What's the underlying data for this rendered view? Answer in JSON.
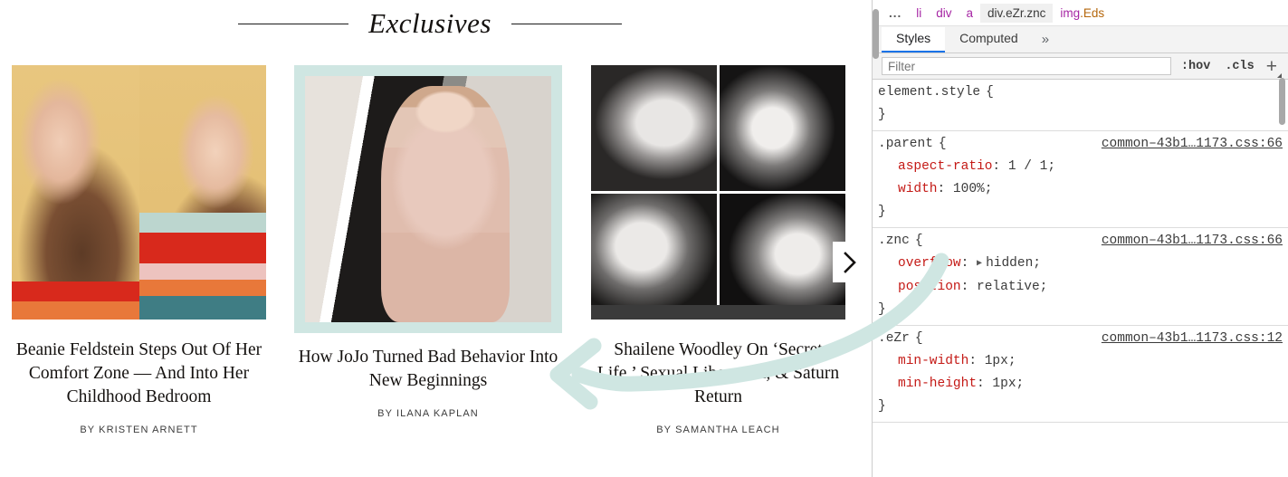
{
  "page": {
    "section": {
      "title": "Exclusives"
    },
    "carousel": {
      "next_label": "›",
      "cards": [
        {
          "headline": "Beanie Feldstein Steps Out Of Her Comfort Zone — And Into Her Childhood Bedroom",
          "byline": "BY KRISTEN ARNETT"
        },
        {
          "headline": "How JoJo Turned Bad Behavior Into New Beginnings",
          "byline": "BY ILANA KAPLAN"
        },
        {
          "headline": "Shailene Woodley On ‘Secret Life,’ Sexual Liberation, & Saturn Return",
          "byline": "BY SAMANTHA LEACH"
        }
      ]
    }
  },
  "devtools": {
    "breadcrumb": [
      {
        "text": "...",
        "kind": "dots"
      },
      {
        "text": "li",
        "kind": "tag"
      },
      {
        "text": "div",
        "kind": "tag"
      },
      {
        "text": "a",
        "kind": "tag"
      },
      {
        "text": "div.eZr.znc",
        "kind": "selected"
      },
      {
        "text": "img.Eds",
        "kind": "tagcls"
      }
    ],
    "breadcrumb_selected_tag": "div",
    "breadcrumb_selected_cls": ".eZr.znc",
    "breadcrumb_last_tag": "img",
    "breadcrumb_last_cls": ".Eds",
    "tabs": [
      {
        "label": "Styles",
        "active": true
      },
      {
        "label": "Computed",
        "active": false
      }
    ],
    "tabs_overflow": "»",
    "filter": {
      "placeholder": "Filter",
      "value": ""
    },
    "buttons": {
      "hov": ":hov",
      "cls": ".cls",
      "add": "+"
    },
    "rules": [
      {
        "selector": "element.style",
        "open": "{",
        "close": "}",
        "origin": "",
        "declarations": []
      },
      {
        "selector": ".parent",
        "open": "{",
        "close": "}",
        "origin": "common–43b1…1173.css:66",
        "declarations": [
          {
            "prop": "aspect-ratio",
            "value": "1 / 1;",
            "highlight": true,
            "expander": false
          },
          {
            "prop": "width",
            "value": "100%;",
            "highlight": false,
            "expander": false
          }
        ]
      },
      {
        "selector": ".znc",
        "open": "{",
        "close": "}",
        "origin": "common–43b1…1173.css:66",
        "declarations": [
          {
            "prop": "overflow",
            "value": "hidden;",
            "highlight": false,
            "expander": true
          },
          {
            "prop": "position",
            "value": "relative;",
            "highlight": false,
            "expander": false
          }
        ]
      },
      {
        "selector": ".eZr",
        "open": "{",
        "close": "}",
        "origin": "common–43b1…1173.css:12",
        "declarations": [
          {
            "prop": "min-width",
            "value": "1px;",
            "highlight": false,
            "expander": false
          },
          {
            "prop": "min-height",
            "value": "1px;",
            "highlight": false,
            "expander": false
          }
        ]
      }
    ]
  },
  "annotation": {
    "arrow_color": "#cfe6e2"
  }
}
